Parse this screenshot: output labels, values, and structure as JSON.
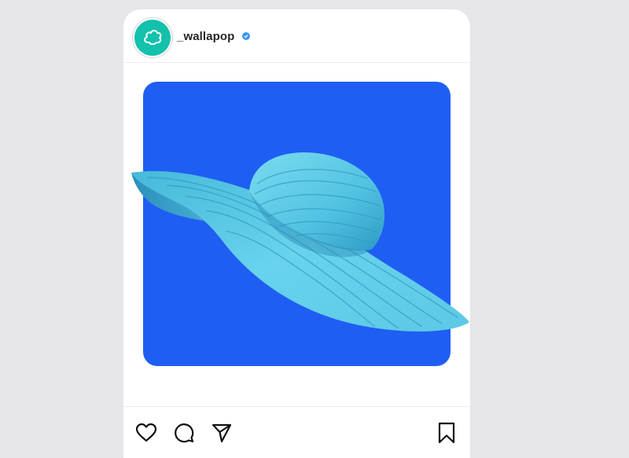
{
  "post": {
    "username": "_wallapop",
    "verified": true,
    "avatar_icon": "wallapop-logo-icon",
    "image_subject": "hat-image"
  },
  "actions": {
    "like_icon": "heart-icon",
    "comment_icon": "comment-icon",
    "share_icon": "send-icon",
    "save_icon": "bookmark-icon"
  },
  "colors": {
    "background": "#e6e6e8",
    "card": "#ffffff",
    "image_background": "#1f5ef2",
    "avatar": "#13c1ac",
    "verified_badge": "#3897f0",
    "hat": "#5fd0ea"
  }
}
